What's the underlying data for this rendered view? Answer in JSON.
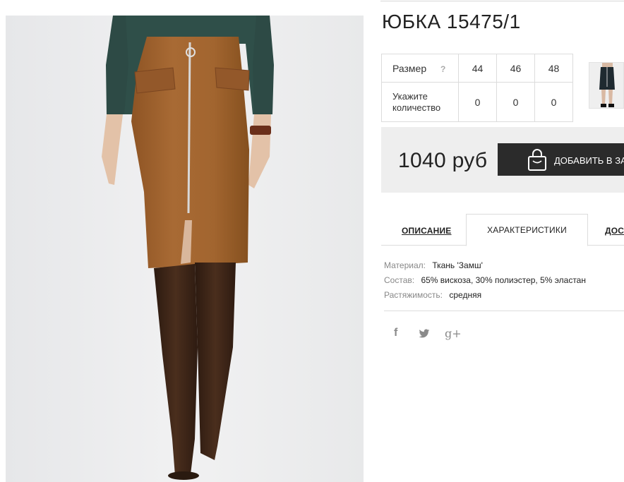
{
  "product": {
    "title": "ЮБКА 15475/1",
    "image_alt": "Юбка из замши с молнией"
  },
  "size_table": {
    "size_label": "Размер",
    "help_icon_text": "?",
    "sizes": [
      "44",
      "46",
      "48"
    ],
    "qty_label_line1": "Укажите",
    "qty_label_line2": "количество",
    "quantities": [
      "0",
      "0",
      "0"
    ]
  },
  "purchase": {
    "price": "1040 руб",
    "add_to_cart_label": "ДОБАВИТЬ В ЗАКАЗ"
  },
  "tabs": [
    {
      "label": "ОПИСАНИЕ",
      "active": false
    },
    {
      "label": "ХАРАКТЕРИСТИКИ",
      "active": true
    },
    {
      "label": "ДОСТАВКА",
      "active": false
    }
  ],
  "characteristics": [
    {
      "key": "Материал:",
      "value": "Ткань 'Замш'"
    },
    {
      "key": "Состав:",
      "value": "65% вискоза, 30% полиэстер, 5% эластан"
    },
    {
      "key": "Растяжимость:",
      "value": "средняя"
    }
  ],
  "social": {
    "facebook_icon": "f",
    "twitter_icon": "twitter-bird",
    "google_plus_icon": "g+"
  },
  "colors": {
    "skirt": "#a0632f",
    "sweater": "#2f4f49",
    "boots": "#3b2417",
    "button": "#2b2b2b",
    "buy_box": "#eeeeee"
  }
}
